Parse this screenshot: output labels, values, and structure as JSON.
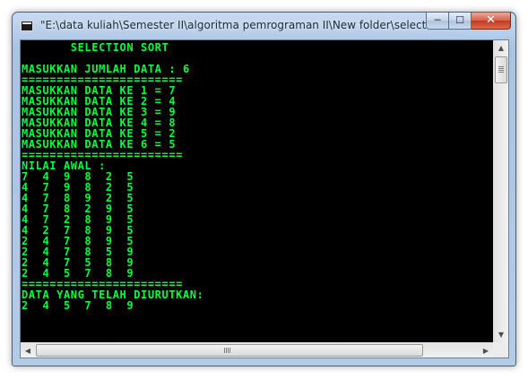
{
  "window": {
    "title": "\"E:\\data kuliah\\Semester II\\algoritma pemrograman II\\New folder\\selection s...",
    "minimize_label": "─",
    "maximize_label": "☐",
    "close_label": "✕"
  },
  "console": {
    "lines": [
      "       SELECTION SORT",
      "",
      "MASUKKAN JUMLAH DATA : 6",
      "=======================",
      "MASUKKAN DATA KE 1 = 7",
      "MASUKKAN DATA KE 2 = 4",
      "MASUKKAN DATA KE 3 = 9",
      "MASUKKAN DATA KE 4 = 8",
      "MASUKKAN DATA KE 5 = 2",
      "MASUKKAN DATA KE 6 = 5",
      "=======================",
      "NILAI AWAL :",
      "7  4  9  8  2  5",
      "4  7  9  8  2  5",
      "4  7  8  9  2  5",
      "4  7  8  2  9  5",
      "4  7  2  8  9  5",
      "4  2  7  8  9  5",
      "2  4  7  8  9  5",
      "2  4  7  8  5  9",
      "2  4  7  5  8  9",
      "2  4  5  7  8  9",
      "=======================",
      "DATA YANG TELAH DIURUTKAN:",
      "2  4  5  7  8  9"
    ]
  },
  "scrollbars": {
    "up_arrow": "▲",
    "down_arrow": "▼",
    "left_arrow": "◀",
    "right_arrow": "▶"
  },
  "colors": {
    "console_text": "#00ff40",
    "console_background": "#000000"
  }
}
